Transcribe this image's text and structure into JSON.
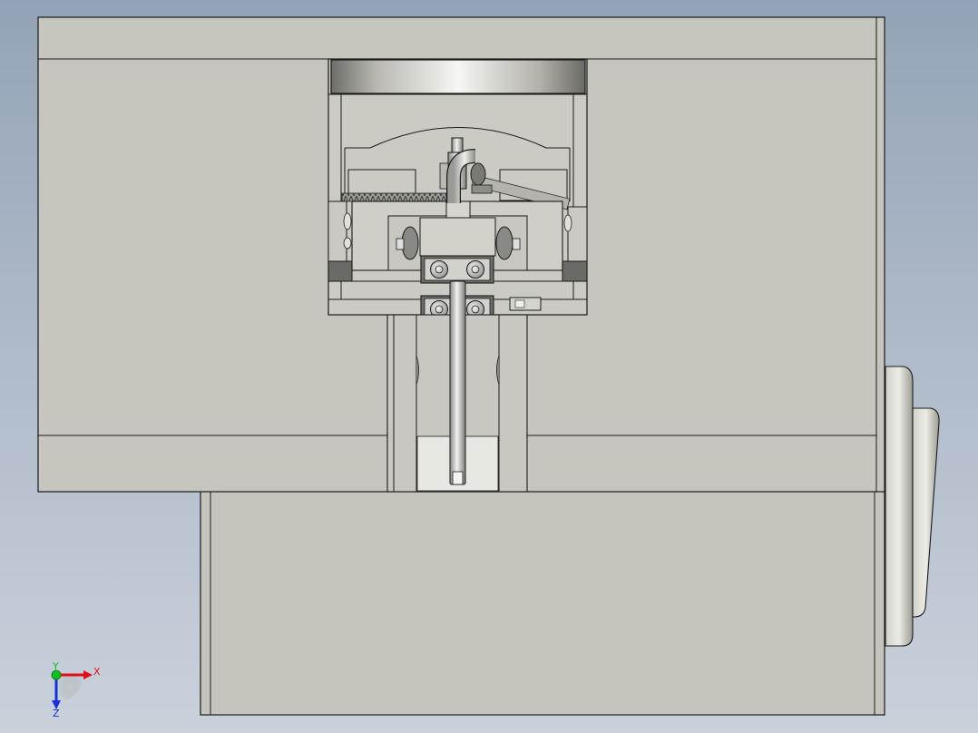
{
  "triad": {
    "x_label": "X",
    "y_label": "Y",
    "z_label": "Z",
    "x_color": "#e0101a",
    "y_color": "#12c020",
    "z_color": "#1830d8"
  },
  "colors": {
    "part_fill": "#c5c5bd",
    "part_fill_light": "#cfcfc8",
    "edge": "#1a1a1a",
    "dark_pad": "#6a6a66",
    "metal_light": "#f2f2ee",
    "metal_mid": "#a9a9a2",
    "metal_dark": "#6e6e68"
  }
}
